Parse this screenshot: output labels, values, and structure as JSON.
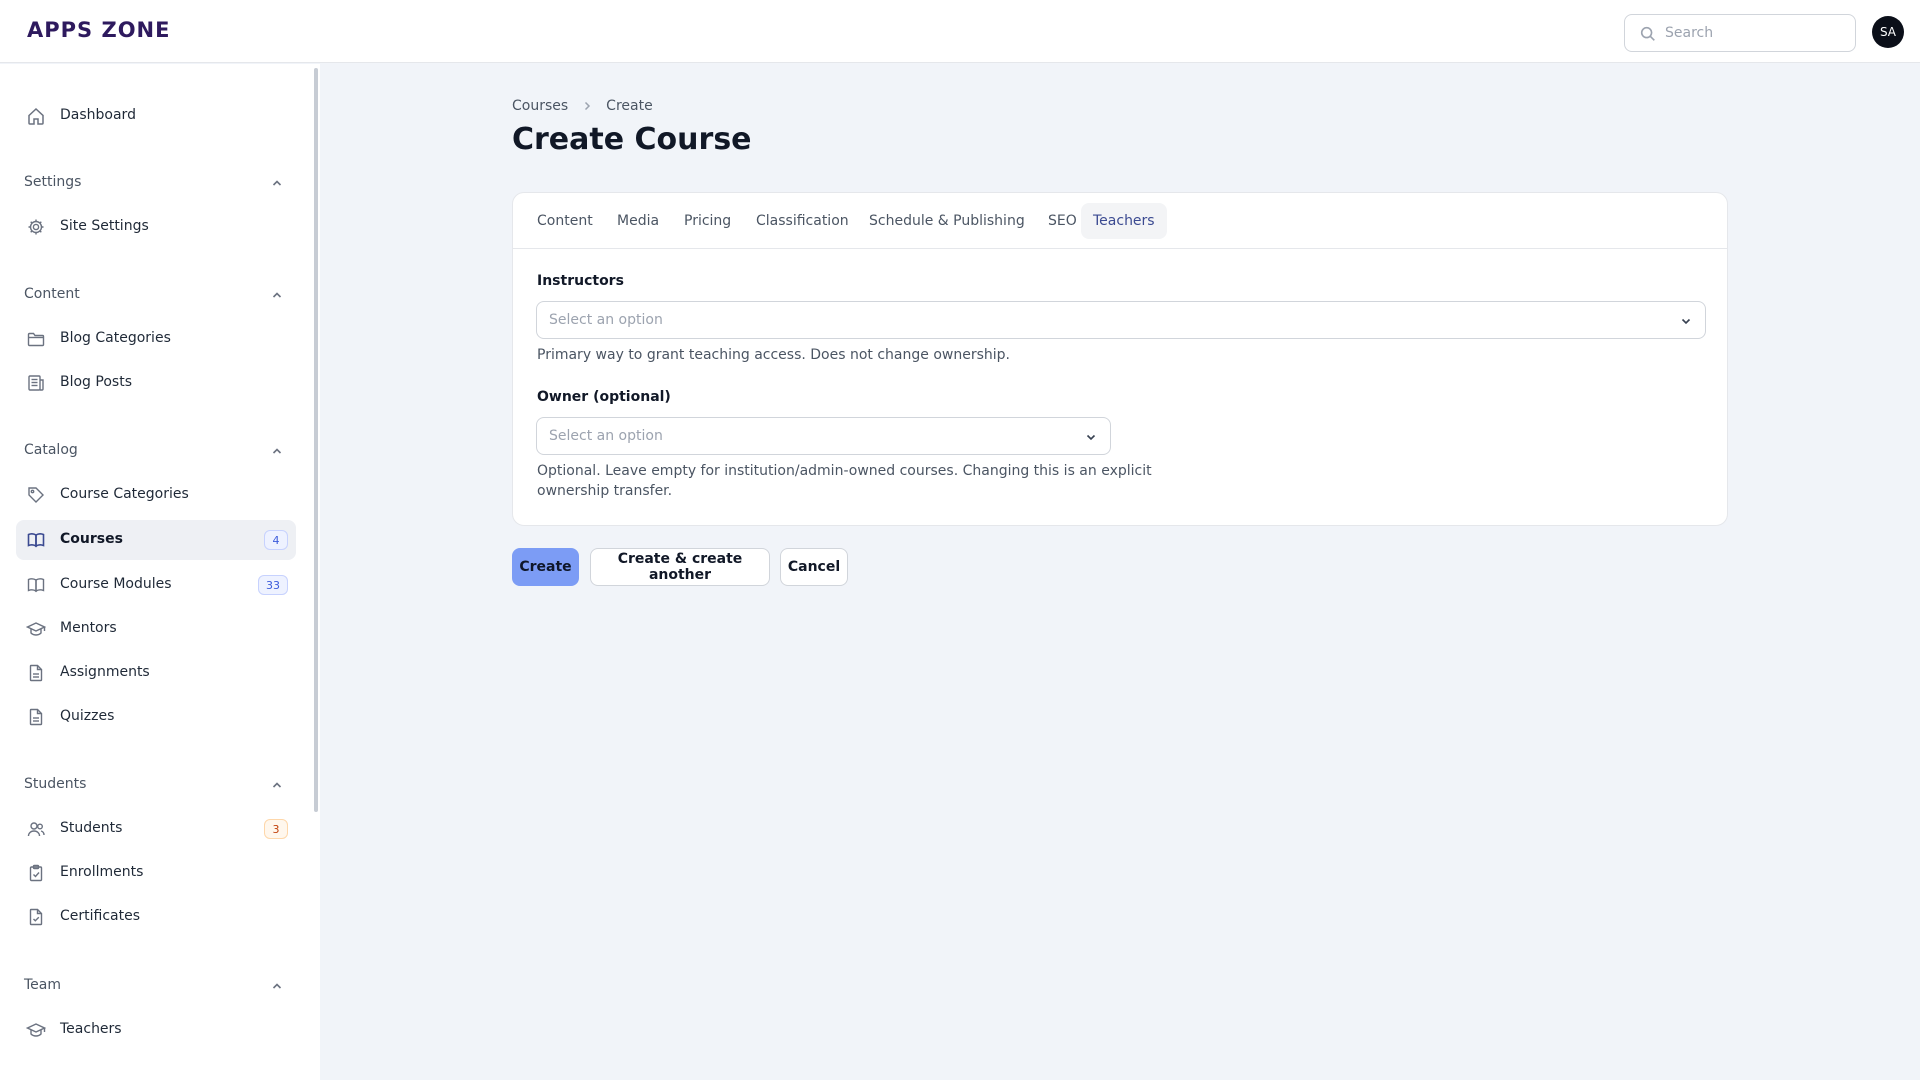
{
  "app": {
    "logo": "APPS ZONE",
    "avatar": "SA"
  },
  "search": {
    "placeholder": "Search"
  },
  "sidebar": {
    "dashboard": "Dashboard",
    "groups": {
      "settings": "Settings",
      "content": "Content",
      "catalog": "Catalog",
      "students": "Students",
      "team": "Team"
    },
    "items": {
      "site_settings": "Site Settings",
      "blog_categories": "Blog Categories",
      "blog_posts": "Blog Posts",
      "course_categories": "Course Categories",
      "courses": "Courses",
      "courses_count": "4",
      "course_modules": "Course Modules",
      "course_modules_count": "33",
      "mentors": "Mentors",
      "assignments": "Assignments",
      "quizzes": "Quizzes",
      "students": "Students",
      "students_count": "3",
      "enrollments": "Enrollments",
      "certificates": "Certificates",
      "teachers": "Teachers"
    }
  },
  "breadcrumb": {
    "parent": "Courses",
    "current": "Create"
  },
  "page": {
    "title": "Create Course"
  },
  "tabs": [
    {
      "label": "Content"
    },
    {
      "label": "Media"
    },
    {
      "label": "Pricing"
    },
    {
      "label": "Classification"
    },
    {
      "label": "Schedule & Publishing"
    },
    {
      "label": "SEO"
    },
    {
      "label": "Teachers",
      "active": true
    }
  ],
  "form": {
    "instructors": {
      "label": "Instructors",
      "placeholder": "Select an option",
      "hint": "Primary way to grant teaching access. Does not change ownership."
    },
    "owner": {
      "label": "Owner (optional)",
      "placeholder": "Select an option",
      "hint_line1": "Optional. Leave empty for institution/admin-owned courses. Changing this is an explicit",
      "hint_line2": "ownership transfer."
    }
  },
  "actions": {
    "create": "Create",
    "create_another": "Create & create another",
    "cancel": "Cancel"
  },
  "colors": {
    "primary_button": "#7c9cf5",
    "active_tab_text": "#3b4a91",
    "badge_blue": "#3b5bdb",
    "badge_orange": "#c2410c"
  }
}
